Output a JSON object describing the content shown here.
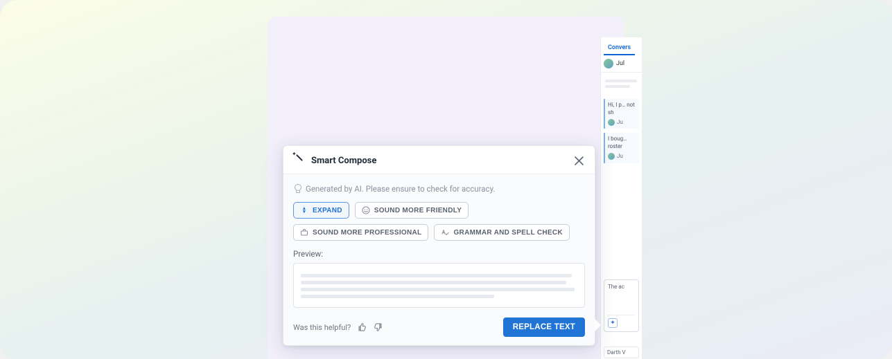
{
  "popover": {
    "title": "Smart Compose",
    "info": "Generated by AI. Please ensure to check for accuracy.",
    "chips": {
      "expand": "EXPAND",
      "friendly": "SOUND MORE FRIENDLY",
      "professional": "SOUND MORE PROFESSIONAL",
      "grammar": "GRAMMAR AND SPELL CHECK"
    },
    "preview_label": "Preview:",
    "helpful": "Was this helpful?",
    "replace": "REPLACE TEXT"
  },
  "conversation": {
    "tab": "Convers",
    "user_name": "Jul",
    "msg1": "Hi, I p… not sh",
    "msg1_from": "Ju",
    "msg2": "I boug… roster",
    "msg2_from": "Ju",
    "input_text": "The ac",
    "footer_user": "Darth V"
  }
}
